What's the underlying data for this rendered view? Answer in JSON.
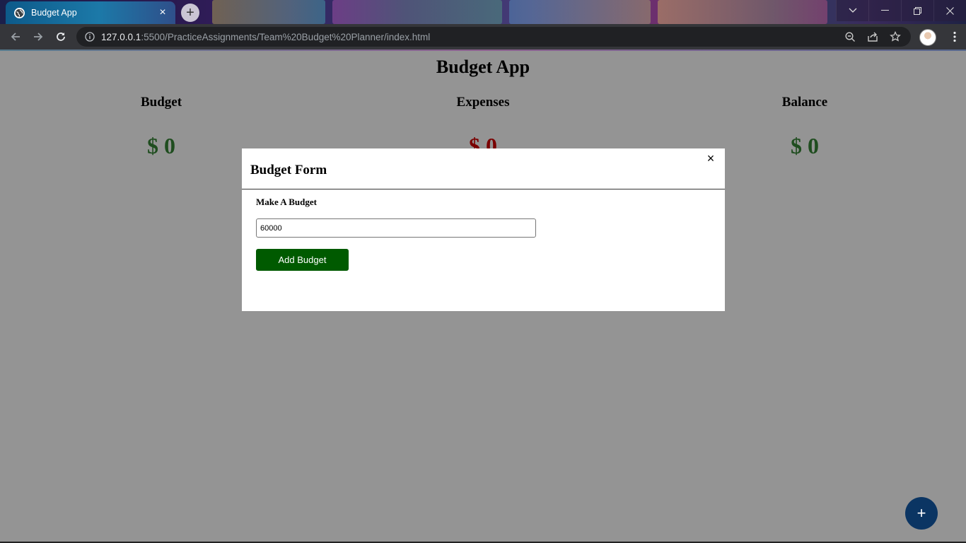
{
  "browser": {
    "tab_title": "Budget App",
    "tab_close": "×",
    "new_tab": "+",
    "url_host": "127.0.0.1",
    "url_rest": ":5500/PracticeAssignments/Team%20Budget%20Planner/index.html"
  },
  "page": {
    "title": "Budget App",
    "budget_label": "Budget",
    "budget_amount": "$ 0",
    "expenses_label": "Expenses",
    "expenses_amount": "$ 0",
    "balance_label": "Balance",
    "balance_amount": "$ 0",
    "fab_label": "+"
  },
  "modal": {
    "title": "Budget Form",
    "close": "×",
    "field_label": "Make A Budget",
    "input_value": "60000",
    "submit_label": "Add Budget"
  },
  "colors": {
    "page_bg": "#949494",
    "amount_green": "#1f4d1f",
    "amount_red": "#7a0000",
    "button_green": "#005a00",
    "fab_blue": "#0b3563"
  },
  "icons": [
    "globe-icon",
    "back-arrow-icon",
    "forward-arrow-icon",
    "reload-icon",
    "info-icon",
    "zoom-icon",
    "share-icon",
    "bookmark-star-icon",
    "profile-avatar",
    "kebab-menu-icon",
    "close-icon",
    "plus-icon"
  ]
}
